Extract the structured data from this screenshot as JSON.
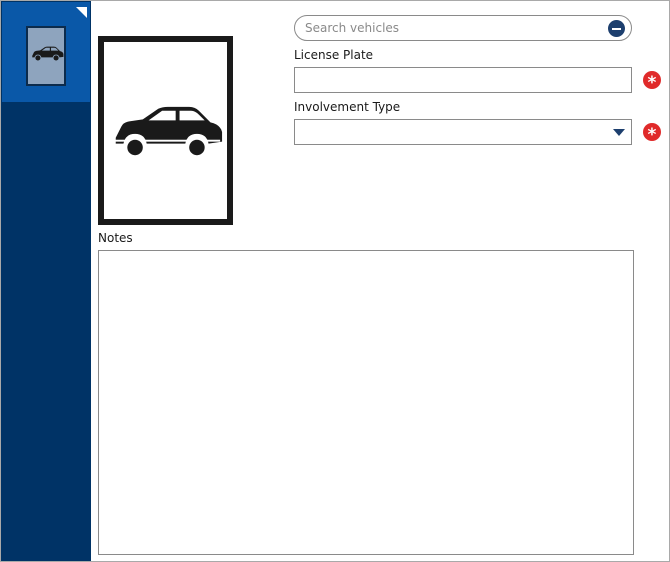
{
  "sidebar": {
    "tabs": [
      {
        "icon": "car-icon",
        "selected": true
      }
    ]
  },
  "photo": {
    "icon": "car-icon"
  },
  "search": {
    "placeholder": "Search vehicles",
    "value": "",
    "clear_icon": "minus-circle-icon"
  },
  "license_plate": {
    "label": "License Plate",
    "value": "",
    "required_icon": "required-asterisk-icon"
  },
  "involvement_type": {
    "label": "Involvement Type",
    "selected": "",
    "dropdown_icon": "chevron-down-icon",
    "required_icon": "required-asterisk-icon"
  },
  "notes": {
    "label": "Notes",
    "value": ""
  },
  "colors": {
    "sidebar": "#003366",
    "sidebar_selected": "#0a58a8",
    "accent": "#1d3f6e",
    "required": "#e02a2a",
    "border": "#8a8a8a"
  }
}
